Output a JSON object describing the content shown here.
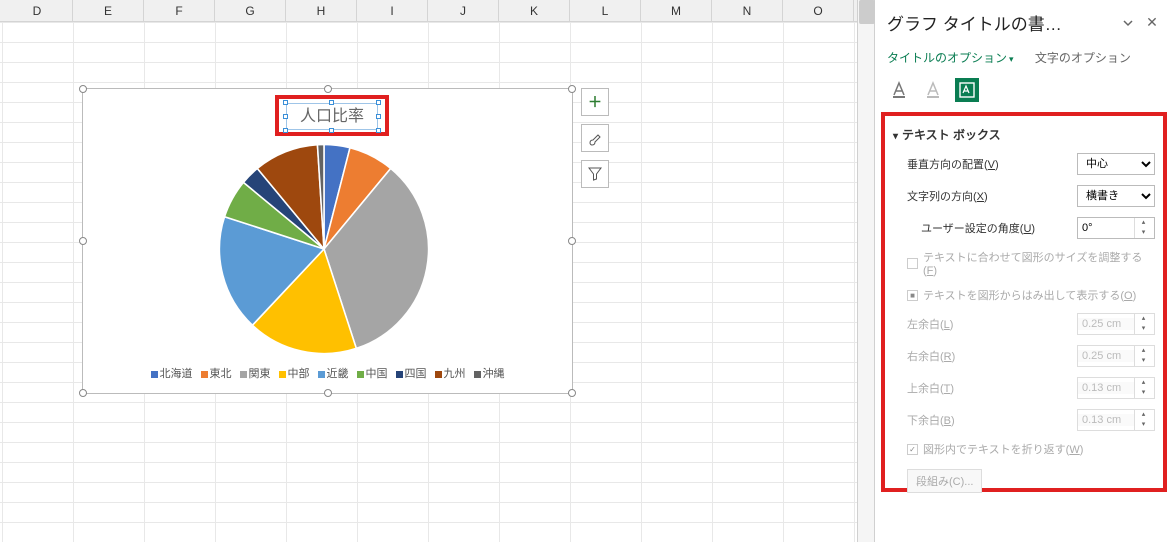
{
  "columns": [
    "D",
    "E",
    "F",
    "G",
    "H",
    "I",
    "J",
    "K",
    "L",
    "M",
    "N",
    "O"
  ],
  "chart_data": {
    "type": "pie",
    "title": "人口比率",
    "series_name": "人口比率",
    "categories": [
      "北海道",
      "東北",
      "関東",
      "中部",
      "近畿",
      "中国",
      "四国",
      "九州",
      "沖縄"
    ],
    "values": [
      4,
      7,
      34,
      17,
      18,
      6,
      3,
      10,
      1
    ],
    "colors": [
      "#4472c4",
      "#ed7d31",
      "#a5a5a5",
      "#ffc000",
      "#5b9bd5",
      "#70ad47",
      "#264478",
      "#9e480e",
      "#636363"
    ]
  },
  "chart_buttons": {
    "plus": "＋",
    "brush": "brush",
    "filter": "filter"
  },
  "panel": {
    "title": "グラフ タイトルの書…",
    "tab_title_options": "タイトルのオプション",
    "tab_text_options": "文字のオプション",
    "section": "テキスト ボックス",
    "v_align": {
      "label": "垂直方向の配置(",
      "key": "V",
      "close": ")",
      "value": "中心"
    },
    "text_dir": {
      "label": "文字列の方向(",
      "key": "X",
      "close": ")",
      "value": "横書き"
    },
    "custom_angle": {
      "label": "ユーザー設定の角度(",
      "key": "U",
      "close": ")",
      "value": "0°"
    },
    "resize_to_text": {
      "label": "テキストに合わせて図形のサイズを調整する(",
      "key": "F",
      "close": ")"
    },
    "overflow": {
      "label": "テキストを図形からはみ出して表示する(",
      "key": "O",
      "close": ")"
    },
    "margin_left": {
      "label": "左余白(",
      "key": "L",
      "close": ")",
      "value": "0.25 cm"
    },
    "margin_right": {
      "label": "右余白(",
      "key": "R",
      "close": ")",
      "value": "0.25 cm"
    },
    "margin_top": {
      "label": "上余白(",
      "key": "T",
      "close": ")",
      "value": "0.13 cm"
    },
    "margin_bottom": {
      "label": "下余白(",
      "key": "B",
      "close": ")",
      "value": "0.13 cm"
    },
    "wrap": {
      "label": "図形内でテキストを折り返す(",
      "key": "W",
      "close": ")"
    },
    "columns": {
      "label": "段組み(",
      "key": "C",
      "close": ")..."
    }
  }
}
